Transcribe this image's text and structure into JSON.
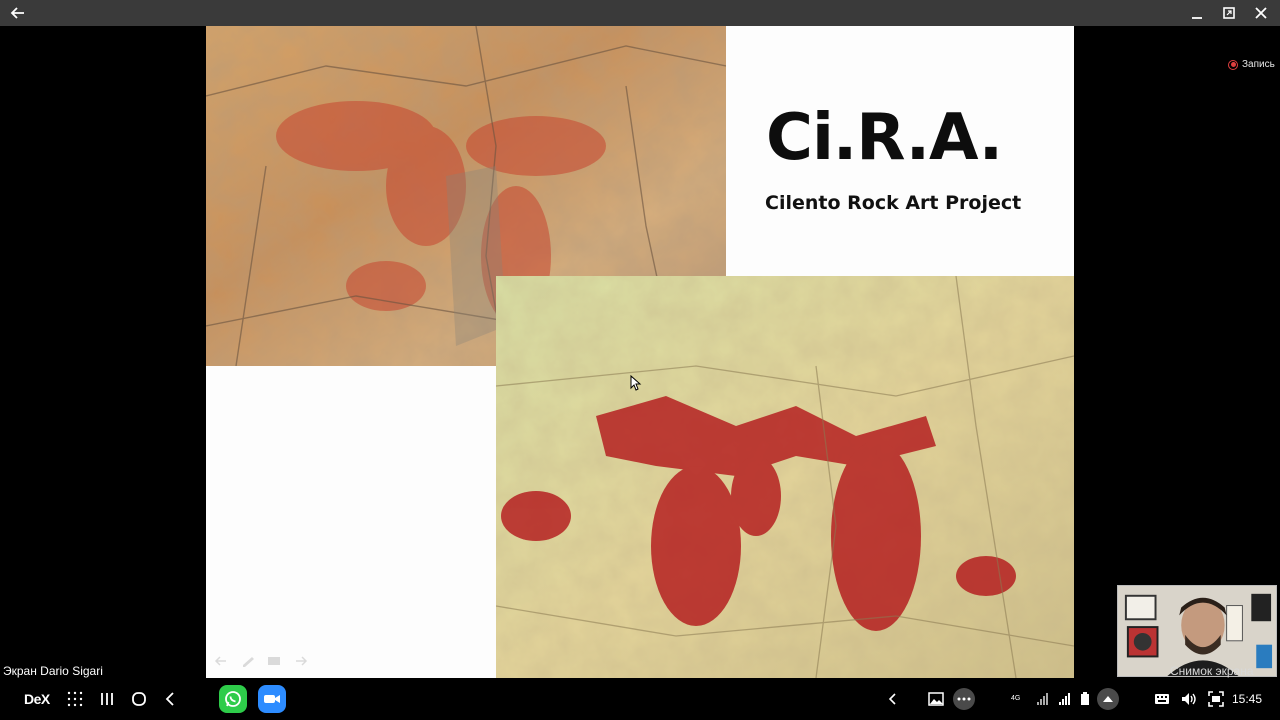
{
  "window": {
    "back_icon": "arrow-left-icon",
    "minimize_icon": "minimize-icon",
    "maximize_icon": "maximize-icon",
    "close_icon": "close-icon"
  },
  "slide": {
    "title": "Ci.R.A.",
    "subtitle": "Cilento Rock Art Project"
  },
  "record": {
    "label": "Запись"
  },
  "screen_share": {
    "label": "Экран Dario Sigari"
  },
  "webcam": {
    "label": "Снимок экрана"
  },
  "taskbar": {
    "dex_label": "DeX",
    "apps": [
      "whatsapp-icon",
      "zoom-icon"
    ],
    "status_network": "4G",
    "time": "15:45"
  },
  "colors": {
    "titlebar": "#3a3a3a",
    "whatsapp": "#2ecc4a",
    "zoom": "#2d8cff",
    "record": "#e04040"
  }
}
